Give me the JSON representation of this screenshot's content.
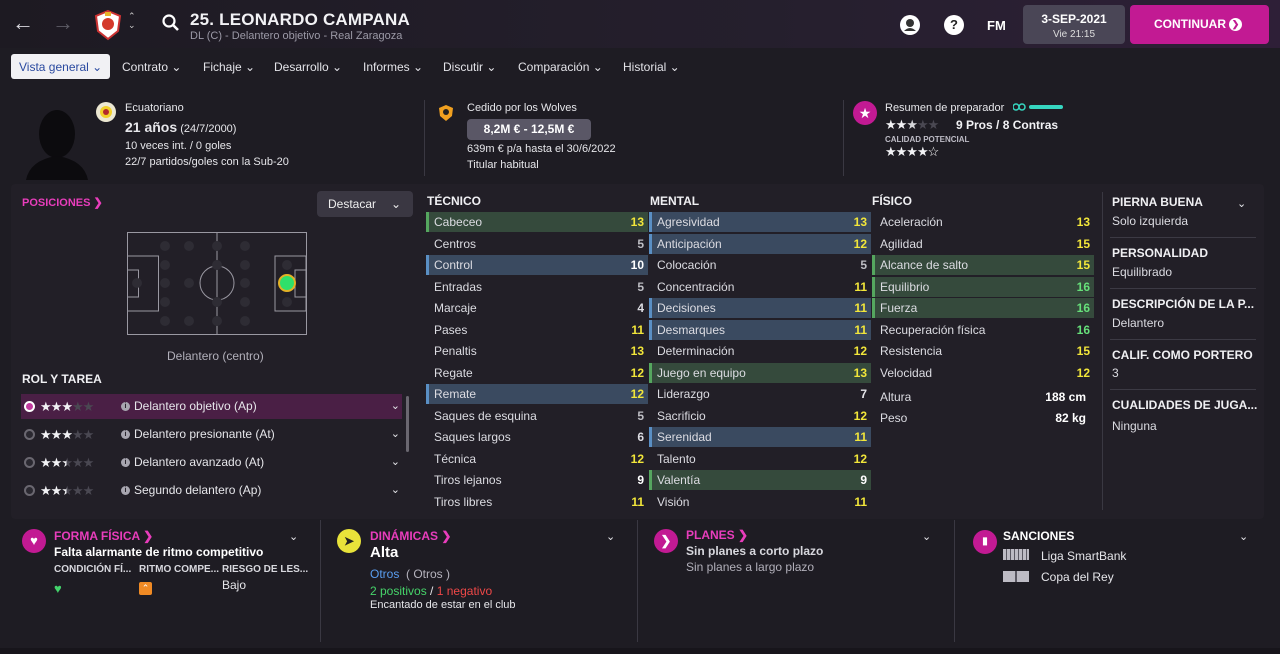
{
  "header": {
    "player_title": "25. LEONARDO CAMPANA",
    "subtitle": "DL (C) - Delantero objetivo - Real Zaragoza",
    "back_icon": "arrow-left-icon",
    "forward_icon": "arrow-right-icon",
    "fm_label": "FM",
    "help_label": "?",
    "date": "3-SEP-2021",
    "day_time": "Vie 21:15",
    "continue_label": "CONTINUAR"
  },
  "menu": {
    "items": [
      "Vista general",
      "Contrato",
      "Fichaje",
      "Desarrollo",
      "Informes",
      "Discutir",
      "Comparación",
      "Historial"
    ]
  },
  "player": {
    "nationality": "Ecuatoriano",
    "age": "21 años",
    "dob": "(24/7/2000)",
    "caps": "10 veces int. / 0 goles",
    "u20": "22/7 partidos/goles con la Sub-20",
    "loan": "Cedido por los Wolves",
    "value": "8,2M € - 12,5M €",
    "wage": "639m € p/a hasta el 30/6/2022",
    "status": "Titular habitual",
    "coach_report": "Resumen de preparador",
    "pros_cons": "9 Pros / 8 Contras",
    "potential_label": "CALIDAD POTENCIAL",
    "current_stars": 3,
    "potential_stars": 4.5
  },
  "positions": {
    "title": "POSICIONES",
    "highlight_label": "Destacar",
    "position_name": "Delantero (centro)"
  },
  "roles": {
    "title": "ROL Y TAREA",
    "items": [
      {
        "label": "Delantero objetivo (Ap)",
        "stars": 3,
        "selected": true
      },
      {
        "label": "Delantero presionante (At)",
        "stars": 3,
        "selected": false
      },
      {
        "label": "Delantero avanzado (At)",
        "stars": 2.5,
        "selected": false
      },
      {
        "label": "Segundo delantero (Ap)",
        "stars": 2.5,
        "selected": false
      }
    ]
  },
  "attributes": {
    "tecnico": {
      "title": "TÉCNICO",
      "rows": [
        {
          "name": "Cabeceo",
          "value": 13,
          "hl": "green"
        },
        {
          "name": "Centros",
          "value": 5,
          "hl": ""
        },
        {
          "name": "Control",
          "value": 10,
          "hl": "blue"
        },
        {
          "name": "Entradas",
          "value": 5,
          "hl": ""
        },
        {
          "name": "Marcaje",
          "value": 4,
          "hl": ""
        },
        {
          "name": "Pases",
          "value": 11,
          "hl": ""
        },
        {
          "name": "Penaltis",
          "value": 13,
          "hl": ""
        },
        {
          "name": "Regate",
          "value": 12,
          "hl": ""
        },
        {
          "name": "Remate",
          "value": 12,
          "hl": "blue"
        },
        {
          "name": "Saques de esquina",
          "value": 5,
          "hl": ""
        },
        {
          "name": "Saques largos",
          "value": 6,
          "hl": ""
        },
        {
          "name": "Técnica",
          "value": 12,
          "hl": ""
        },
        {
          "name": "Tiros lejanos",
          "value": 9,
          "hl": ""
        },
        {
          "name": "Tiros libres",
          "value": 11,
          "hl": ""
        }
      ]
    },
    "mental": {
      "title": "MENTAL",
      "rows": [
        {
          "name": "Agresividad",
          "value": 13,
          "hl": "blue"
        },
        {
          "name": "Anticipación",
          "value": 12,
          "hl": "blue"
        },
        {
          "name": "Colocación",
          "value": 5,
          "hl": ""
        },
        {
          "name": "Concentración",
          "value": 11,
          "hl": ""
        },
        {
          "name": "Decisiones",
          "value": 11,
          "hl": "blue"
        },
        {
          "name": "Desmarques",
          "value": 11,
          "hl": "blue"
        },
        {
          "name": "Determinación",
          "value": 12,
          "hl": ""
        },
        {
          "name": "Juego en equipo",
          "value": 13,
          "hl": "green"
        },
        {
          "name": "Liderazgo",
          "value": 7,
          "hl": ""
        },
        {
          "name": "Sacrificio",
          "value": 12,
          "hl": ""
        },
        {
          "name": "Serenidad",
          "value": 11,
          "hl": "blue"
        },
        {
          "name": "Talento",
          "value": 12,
          "hl": ""
        },
        {
          "name": "Valentía",
          "value": 9,
          "hl": "green"
        },
        {
          "name": "Visión",
          "value": 11,
          "hl": ""
        }
      ]
    },
    "fisico": {
      "title": "FÍSICO",
      "rows": [
        {
          "name": "Aceleración",
          "value": 13,
          "hl": ""
        },
        {
          "name": "Agilidad",
          "value": 15,
          "hl": ""
        },
        {
          "name": "Alcance de salto",
          "value": 15,
          "hl": "green"
        },
        {
          "name": "Equilibrio",
          "value": 16,
          "hl": "green"
        },
        {
          "name": "Fuerza",
          "value": 16,
          "hl": "green"
        },
        {
          "name": "Recuperación física",
          "value": 16,
          "hl": ""
        },
        {
          "name": "Resistencia",
          "value": 15,
          "hl": ""
        },
        {
          "name": "Velocidad",
          "value": 12,
          "hl": ""
        }
      ],
      "height_label": "Altura",
      "height": "188 cm",
      "weight_label": "Peso",
      "weight": "82 kg"
    }
  },
  "details": {
    "foot_t": "PIERNA BUENA",
    "foot_v": "Solo izquierda",
    "pers_t": "PERSONALIDAD",
    "pers_v": "Equilibrado",
    "desc_t": "DESCRIPCIÓN DE LA P...",
    "desc_v": "Delantero",
    "gk_t": "CALIF. COMO PORTERO",
    "gk_v": "3",
    "qual_t": "CUALIDADES DE JUGA...",
    "qual_v": "Ninguna"
  },
  "bottom": {
    "fitness_title": "FORMA FÍSICA",
    "fitness_status": "Falta alarmante de ritmo competitivo",
    "cond_label": "CONDICIÓN FÍ...",
    "match_label": "RITMO COMPE...",
    "injury_label": "RIESGO DE LES...",
    "injury_value": "Bajo",
    "dyn_title": "DINÁMICAS",
    "dyn_value": "Alta",
    "dyn_group": "Otros",
    "dyn_group2": "( Otros )",
    "dyn_pos": "2 positivos",
    "dyn_sep": "/",
    "dyn_neg": "1 negativo",
    "dyn_note": "Encantado de estar en el club",
    "plans_title": "PLANES",
    "plans_short": "Sin planes a corto plazo",
    "plans_long": "Sin planes a largo plazo",
    "sanc_title": "SANCIONES",
    "sanc_1": "Liga SmartBank",
    "sanc_2": "Copa del Rey"
  },
  "colors": {
    "accent": "#c21a93",
    "pink": "#e93dbc",
    "green": "#66e07a",
    "yellow": "#f2e63a"
  }
}
